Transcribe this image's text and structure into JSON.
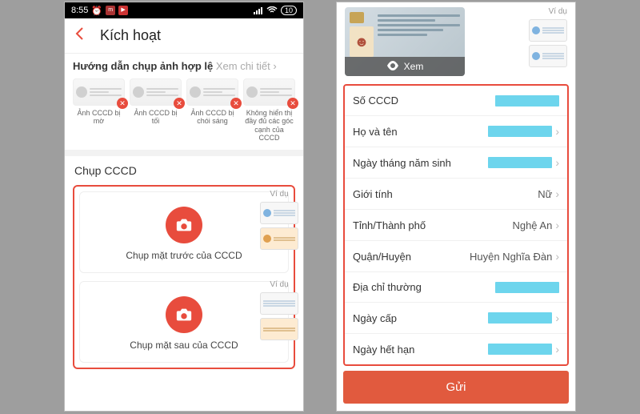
{
  "status": {
    "time": "8:55",
    "battery": "10"
  },
  "header": {
    "title": "Kích hoạt"
  },
  "guide": {
    "title": "Hướng dẫn chụp ảnh hợp lệ",
    "link": "Xem chi tiết",
    "items": [
      {
        "label": "Ảnh CCCD bị mờ"
      },
      {
        "label": "Ảnh CCCD bị tối"
      },
      {
        "label": "Ảnh CCCD bị chói sáng"
      },
      {
        "label": "Không hiển thị đầy đủ các góc cạnh của CCCD"
      }
    ]
  },
  "capture": {
    "section_title": "Chụp CCCD",
    "example_label": "Ví dụ",
    "front_label": "Chụp mặt trước của CCCD",
    "back_label": "Chụp mặt sau của CCCD"
  },
  "preview": {
    "view_label": "Xem",
    "example_label": "Ví dụ"
  },
  "form": {
    "rows": [
      {
        "label": "Số CCCD",
        "value": "",
        "redacted": true,
        "chevron": false
      },
      {
        "label": "Họ và tên",
        "value": "",
        "redacted": true,
        "chevron": true
      },
      {
        "label": "Ngày tháng năm sinh",
        "value": "",
        "redacted": true,
        "chevron": true
      },
      {
        "label": "Giới tính",
        "value": "Nữ",
        "redacted": false,
        "chevron": true
      },
      {
        "label": "Tỉnh/Thành phố",
        "value": "Nghệ An",
        "redacted": false,
        "chevron": true
      },
      {
        "label": "Quận/Huyện",
        "value": "Huyện Nghĩa Đàn",
        "redacted": false,
        "chevron": true
      },
      {
        "label": "Địa chỉ thường",
        "value": "",
        "redacted": true,
        "chevron": false
      },
      {
        "label": "Ngày cấp",
        "value": "",
        "redacted": true,
        "chevron": true
      },
      {
        "label": "Ngày hết hạn",
        "value": "",
        "redacted": true,
        "chevron": true
      }
    ]
  },
  "submit": {
    "label": "Gửi"
  }
}
